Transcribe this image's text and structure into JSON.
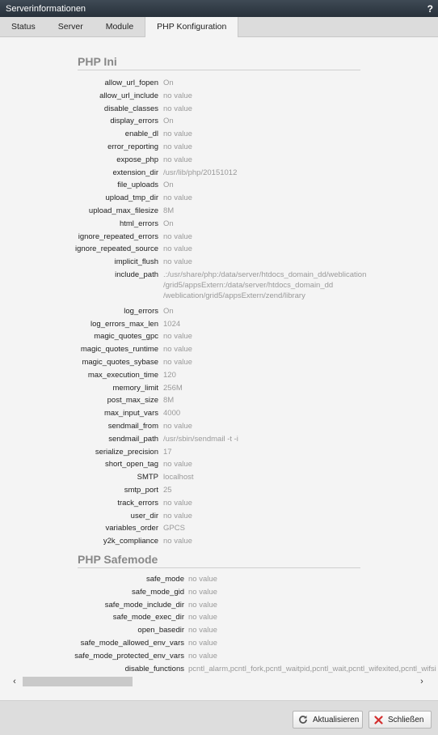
{
  "window": {
    "title": "Serverinformationen",
    "help_label": "?"
  },
  "tabs": [
    {
      "label": "Status"
    },
    {
      "label": "Server"
    },
    {
      "label": "Module"
    },
    {
      "label": "PHP Konfiguration"
    }
  ],
  "php_ini": {
    "title": "PHP Ini",
    "entries": [
      {
        "key": "allow_url_fopen",
        "value": "On"
      },
      {
        "key": "allow_url_include",
        "value": "no value"
      },
      {
        "key": "disable_classes",
        "value": "no value"
      },
      {
        "key": "display_errors",
        "value": "On"
      },
      {
        "key": "enable_dl",
        "value": "no value"
      },
      {
        "key": "error_reporting",
        "value": "no value"
      },
      {
        "key": "expose_php",
        "value": "no value"
      },
      {
        "key": "extension_dir",
        "value": "/usr/lib/php/20151012"
      },
      {
        "key": "file_uploads",
        "value": "On"
      },
      {
        "key": "upload_tmp_dir",
        "value": "no value"
      },
      {
        "key": "upload_max_filesize",
        "value": "8M"
      },
      {
        "key": "html_errors",
        "value": "On"
      },
      {
        "key": "ignore_repeated_errors",
        "value": "no value"
      },
      {
        "key": "ignore_repeated_source",
        "value": "no value"
      },
      {
        "key": "implicit_flush",
        "value": "no value"
      },
      {
        "key": "include_path",
        "value_lines": [
          ".:/usr/share/php:/data/server/htdocs_domain_dd/weblication",
          "/grid5/appsExtern:/data/server/htdocs_domain_dd",
          "/weblication/grid5/appsExtern/zend/library"
        ]
      },
      {
        "key": "log_errors",
        "value": "On"
      },
      {
        "key": "log_errors_max_len",
        "value": "1024"
      },
      {
        "key": "magic_quotes_gpc",
        "value": "no value"
      },
      {
        "key": "magic_quotes_runtime",
        "value": "no value"
      },
      {
        "key": "magic_quotes_sybase",
        "value": "no value"
      },
      {
        "key": "max_execution_time",
        "value": "120"
      },
      {
        "key": "memory_limit",
        "value": "256M"
      },
      {
        "key": "post_max_size",
        "value": "8M"
      },
      {
        "key": "max_input_vars",
        "value": "4000"
      },
      {
        "key": "sendmail_from",
        "value": "no value"
      },
      {
        "key": "sendmail_path",
        "value": "/usr/sbin/sendmail -t -i"
      },
      {
        "key": "serialize_precision",
        "value": "17"
      },
      {
        "key": "short_open_tag",
        "value": "no value"
      },
      {
        "key": "SMTP",
        "value": "localhost"
      },
      {
        "key": "smtp_port",
        "value": "25"
      },
      {
        "key": "track_errors",
        "value": "no value"
      },
      {
        "key": "user_dir",
        "value": "no value"
      },
      {
        "key": "variables_order",
        "value": "GPCS"
      },
      {
        "key": "y2k_compliance",
        "value": "no value"
      }
    ]
  },
  "php_safemode": {
    "title": "PHP Safemode",
    "entries": [
      {
        "key": "safe_mode",
        "value": "no value"
      },
      {
        "key": "safe_mode_gid",
        "value": "no value"
      },
      {
        "key": "safe_mode_include_dir",
        "value": "no value"
      },
      {
        "key": "safe_mode_exec_dir",
        "value": "no value"
      },
      {
        "key": "open_basedir",
        "value": "no value"
      },
      {
        "key": "safe_mode_allowed_env_vars",
        "value": "no value"
      },
      {
        "key": "safe_mode_protected_env_vars",
        "value": "no value"
      },
      {
        "key": "disable_functions",
        "value": "pcntl_alarm,pcntl_fork,pcntl_waitpid,pcntl_wait,pcntl_wifexited,pcntl_wifsi"
      }
    ]
  },
  "footer": {
    "refresh_label": "Aktualisieren",
    "close_label": "Schließen"
  },
  "colors": {
    "close_icon": "#d32f2f",
    "refresh_icon": "#555555"
  }
}
